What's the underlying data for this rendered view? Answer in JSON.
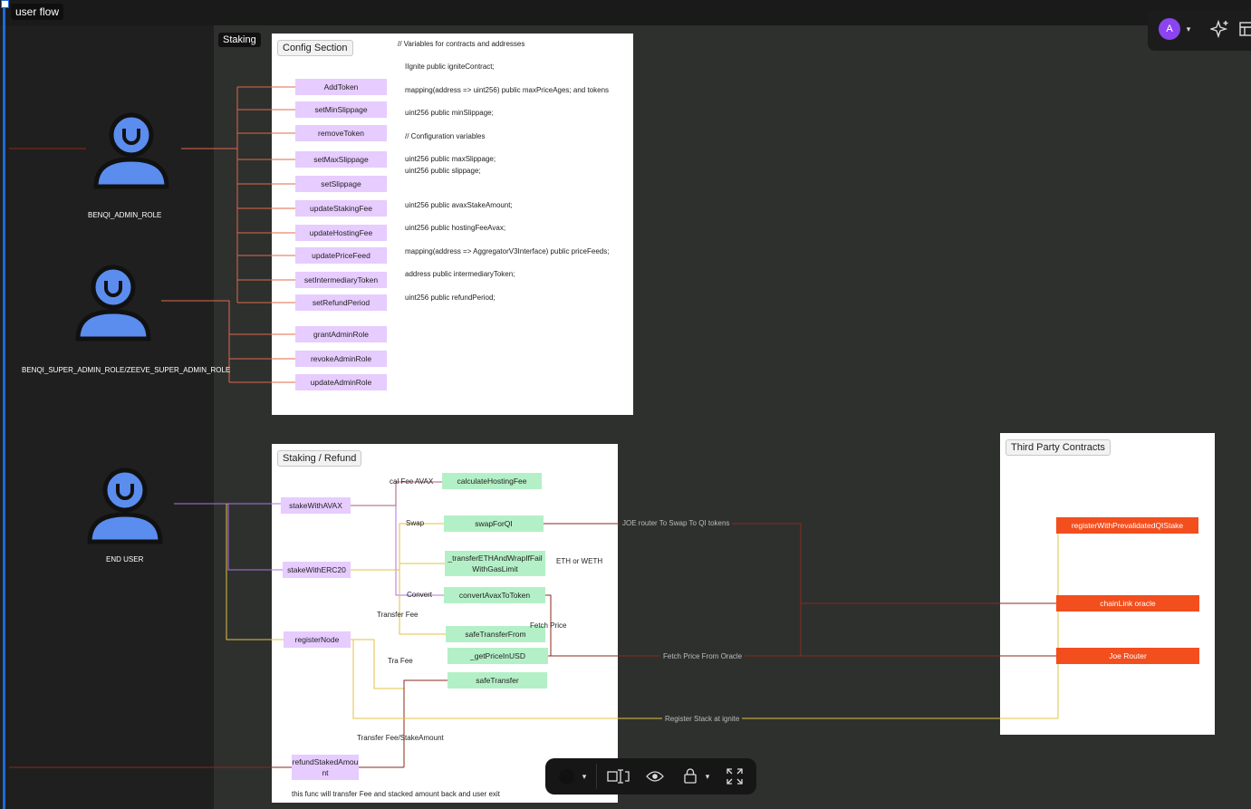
{
  "frame": {
    "flow_label": "user flow",
    "staking_label": "Staking"
  },
  "roles": {
    "admin": "BENQI_ADMIN_ROLE",
    "super_admin": "BENQI_SUPER_ADMIN_ROLE/ZEEVE_SUPER_ADMIN_ROLE",
    "end_user": "END USER"
  },
  "config": {
    "title": "Config Section",
    "functions": [
      "AddToken",
      "setMinSlippage",
      "removeToken",
      "setMaxSlippage",
      "setSlippage",
      "updateStakingFee",
      "updateHostingFee",
      "updatePriceFeed",
      "setIntermediaryToken",
      "setRefundPeriod",
      "grantAdminRole",
      "revokeAdminRole",
      "updateAdminRole"
    ],
    "code": [
      "// Variables for contracts and addresses",
      "IIgnite public igniteContract;",
      "mapping(address => uint256) public maxPriceAges; and tokens",
      "uint256 public minSlippage;",
      "// Configuration variables",
      "uint256 public maxSlippage;",
      "uint256 public slippage;",
      "uint256 public avaxStakeAmount;",
      "uint256 public hostingFeeAvax;",
      "mapping(address => AggregatorV3Interface) public priceFeeds;",
      "address public intermediaryToken;",
      "uint256 public refundPeriod;"
    ]
  },
  "staking": {
    "title": "Staking / Refund",
    "entry": [
      "stakeWithAVAX",
      "stakeWithERC20",
      "registerNode"
    ],
    "refund": "refundStakedAmount",
    "internal": [
      "calculateHostingFee",
      "swapForQI",
      "_transferETHAndWrapIfFailWithGasLimit",
      "convertAvaxToToken",
      "safeTransferFrom",
      "_getPriceInUSD",
      "safeTransfer"
    ],
    "labels": [
      "cal Fee AVAX",
      "Swap",
      "ETH or WETH",
      "Convert",
      "Transfer Fee",
      "Fetch Price",
      "Tra Fee",
      "Transfer Fee/StakeAmount"
    ],
    "note": "this func will transfer Fee and stacked amount back and user exit"
  },
  "third_party": {
    "title": "Third Party Contracts",
    "items": [
      "registerWithPrevalidatedQIStake",
      "chainLink oracle",
      "Joe Router"
    ]
  },
  "connectors": {
    "joe": "JOE router To Swap To QI tokens",
    "oracle": "Fetch Price From Oracle",
    "ignite": "Register Stack at ignite"
  },
  "toolbar": {
    "avatar": "A"
  },
  "colors": {
    "purple": "#e6ccff",
    "green": "#b4f0c7",
    "orange": "#f24e1e",
    "user_blue": "#5b8def"
  }
}
